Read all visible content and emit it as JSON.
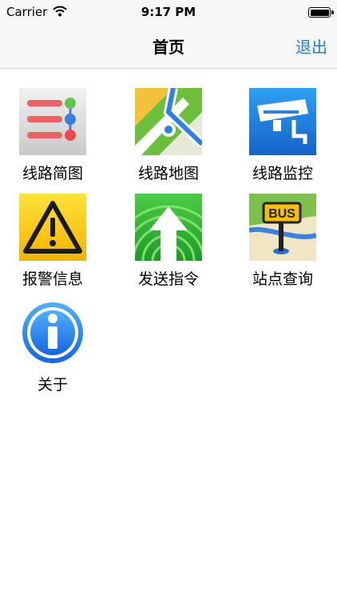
{
  "status_bar": {
    "carrier": "Carrier",
    "time": "9:17 PM"
  },
  "nav": {
    "title": "首页",
    "logout_label": "退出"
  },
  "tiles": [
    {
      "label": "线路简图",
      "icon": "route-diagram-icon"
    },
    {
      "label": "线路地图",
      "icon": "route-map-icon"
    },
    {
      "label": "线路监控",
      "icon": "surveillance-camera-icon"
    },
    {
      "label": "报警信息",
      "icon": "warning-icon"
    },
    {
      "label": "发送指令",
      "icon": "send-arrow-icon"
    },
    {
      "label": "站点查询",
      "icon": "bus-stop-icon"
    },
    {
      "label": "关于",
      "icon": "info-icon"
    }
  ],
  "icon_text": {
    "bus_sign": "BUS"
  },
  "colors": {
    "accent": "#1f7ee6"
  }
}
